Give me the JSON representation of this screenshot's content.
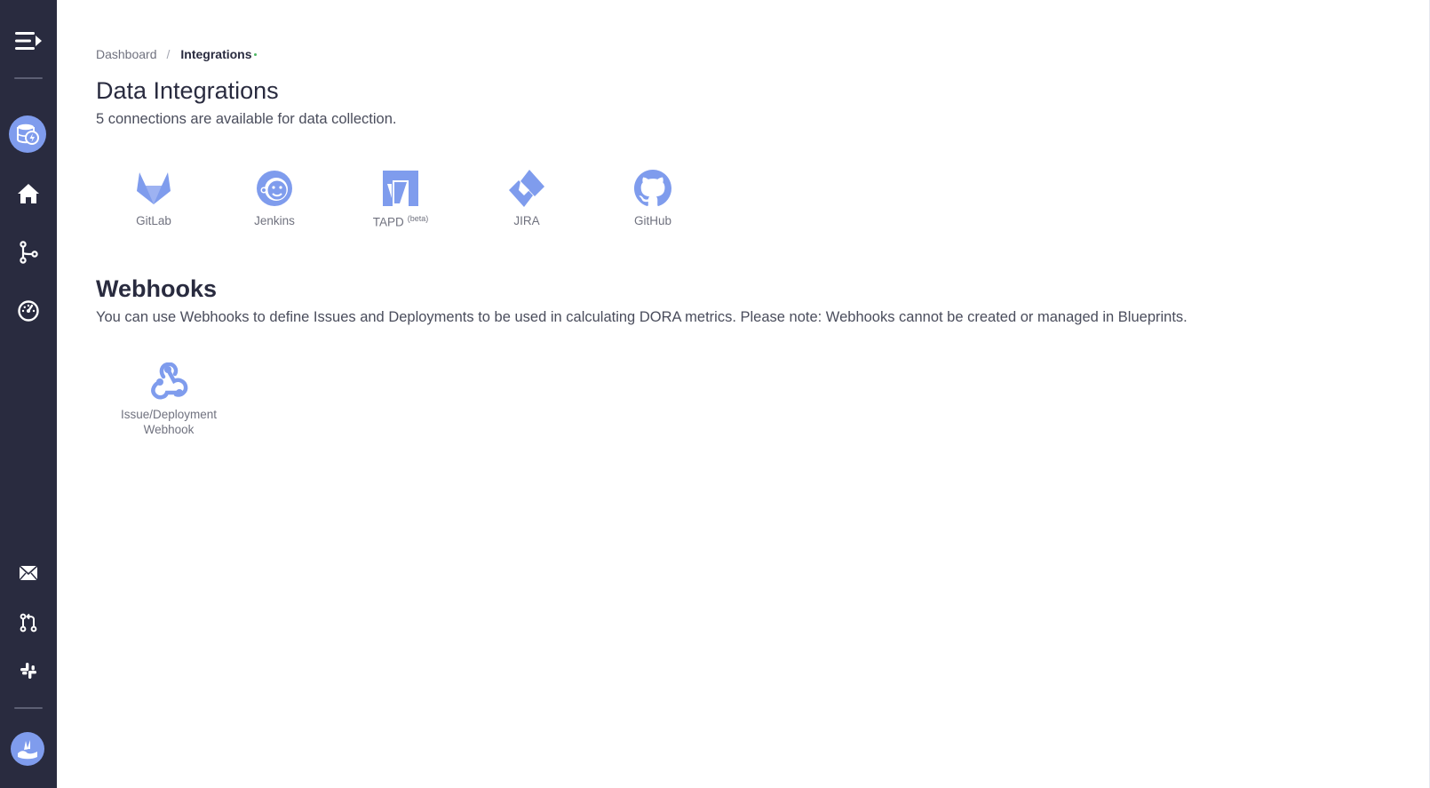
{
  "sidebar": {
    "top_items": [
      {
        "name": "menu-toggle-icon"
      },
      {
        "name": "blueprint-logo"
      },
      {
        "name": "home-icon"
      },
      {
        "name": "pipeline-branch-icon"
      },
      {
        "name": "dashboard-gauge-icon"
      }
    ],
    "bottom_items": [
      {
        "name": "mail-icon"
      },
      {
        "name": "pull-request-icon"
      },
      {
        "name": "slack-icon"
      },
      {
        "name": "user-avatar"
      }
    ],
    "colors": {
      "background": "#292b3f",
      "accent": "#7f9ced"
    }
  },
  "breadcrumb": {
    "root": "Dashboard",
    "separator": "/",
    "current": "Integrations"
  },
  "page": {
    "title": "Data Integrations",
    "subtitle": "5 connections are available for data collection."
  },
  "connections": [
    {
      "label": "GitLab",
      "icon": "gitlab-icon"
    },
    {
      "label": "Jenkins",
      "icon": "jenkins-icon"
    },
    {
      "label": "TAPD",
      "badge": "(beta)",
      "icon": "tapd-icon"
    },
    {
      "label": "JIRA",
      "icon": "jira-icon"
    },
    {
      "label": "GitHub",
      "icon": "github-icon"
    }
  ],
  "webhooks": {
    "title": "Webhooks",
    "description": "You can use Webhooks to define Issues and Deployments to be used in calculating DORA metrics. Please note: Webhooks cannot be created or managed in Blueprints.",
    "items": [
      {
        "label_line1": "Issue/Deployment",
        "label_line2": "Webhook",
        "icon": "webhook-icon"
      }
    ]
  },
  "colors": {
    "icon": "#7f9ced",
    "text_muted": "#70727f",
    "title": "#292b3f"
  }
}
